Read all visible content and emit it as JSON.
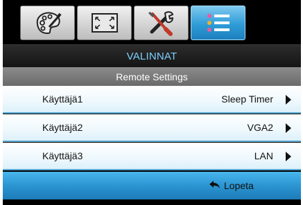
{
  "tabs": [
    {
      "icon": "palette-icon"
    },
    {
      "icon": "screen-resize-icon"
    },
    {
      "icon": "tools-icon"
    },
    {
      "icon": "list-icon",
      "active": true
    }
  ],
  "title": "VALINNAT",
  "section": "Remote Settings",
  "rows": [
    {
      "label": "Käyttäjä1",
      "value": "Sleep Timer"
    },
    {
      "label": "Käyttäjä2",
      "value": "VGA2"
    },
    {
      "label": "Käyttäjä3",
      "value": "LAN"
    }
  ],
  "footer": {
    "exit_label": "Lopeta"
  },
  "colors": {
    "accent": "#2b95d2",
    "title_text": "#7fd0ff"
  }
}
